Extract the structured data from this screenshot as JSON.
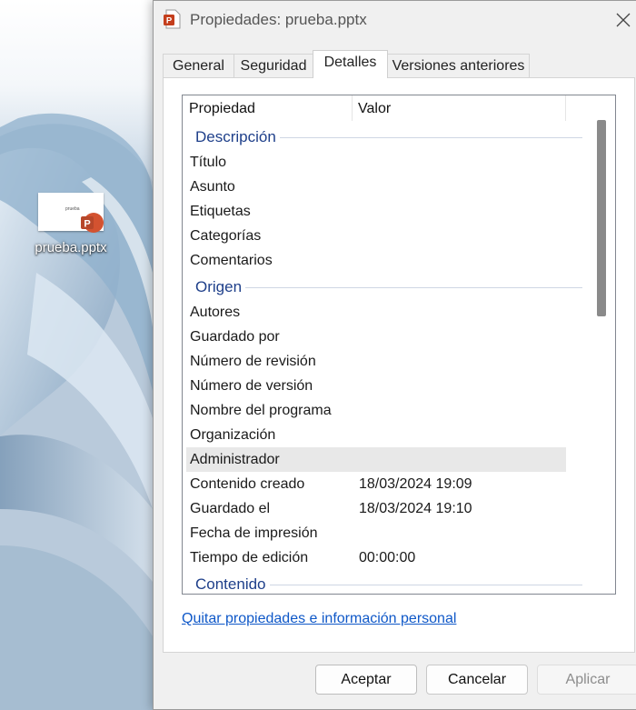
{
  "desktop": {
    "file_icon_label": "prueba.pptx",
    "thumbnail_text": "prueba",
    "badge_letter": "P"
  },
  "dialog": {
    "title": "Propiedades: prueba.pptx",
    "tabs": [
      {
        "label": "General",
        "active": false
      },
      {
        "label": "Seguridad",
        "active": false
      },
      {
        "label": "Detalles",
        "active": true
      },
      {
        "label": "Versiones anteriores",
        "active": false
      }
    ],
    "columns": {
      "property": "Propiedad",
      "value": "Valor"
    },
    "groups": [
      {
        "label": "Descripción",
        "rows": [
          {
            "property": "Título",
            "value": ""
          },
          {
            "property": "Asunto",
            "value": ""
          },
          {
            "property": "Etiquetas",
            "value": ""
          },
          {
            "property": "Categorías",
            "value": ""
          },
          {
            "property": "Comentarios",
            "value": ""
          }
        ]
      },
      {
        "label": "Origen",
        "rows": [
          {
            "property": "Autores",
            "value": ""
          },
          {
            "property": "Guardado por",
            "value": ""
          },
          {
            "property": "Número de revisión",
            "value": ""
          },
          {
            "property": "Número de versión",
            "value": ""
          },
          {
            "property": "Nombre del programa",
            "value": ""
          },
          {
            "property": "Organización",
            "value": ""
          },
          {
            "property": "Administrador",
            "value": "",
            "selected": true
          },
          {
            "property": "Contenido creado",
            "value": "18/03/2024 19:09"
          },
          {
            "property": "Guardado el",
            "value": "18/03/2024 19:10"
          },
          {
            "property": "Fecha de impresión",
            "value": ""
          },
          {
            "property": "Tiempo de edición",
            "value": "00:00:00"
          }
        ]
      },
      {
        "label": "Contenido",
        "rows": []
      }
    ],
    "remove_link": "Quitar propiedades e información personal",
    "buttons": {
      "ok": "Aceptar",
      "cancel": "Cancelar",
      "apply": "Aplicar"
    }
  },
  "colors": {
    "group_label": "#1e3f8a",
    "link": "#0f58c8",
    "ppt_orange": "#d35230"
  },
  "icons": [
    "powerpoint-file-icon",
    "close-icon"
  ]
}
